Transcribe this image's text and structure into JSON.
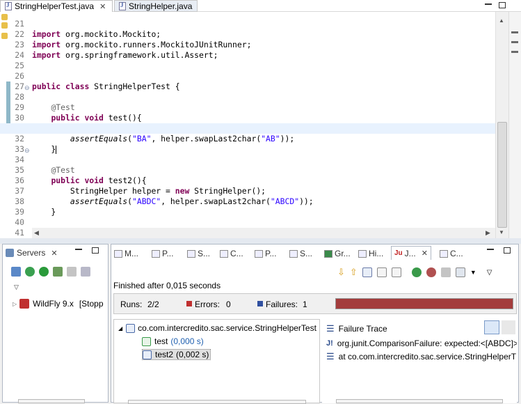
{
  "editor_tabs": [
    {
      "label": "StringHelperTest.java",
      "active": true
    },
    {
      "label": "StringHelper.java",
      "active": false
    }
  ],
  "code_lines": [
    {
      "num": "21",
      "text": "import org.mockito.Mockito;"
    },
    {
      "num": "22",
      "text": "import org.mockito.runners.MockitoJUnitRunner;"
    },
    {
      "num": "23",
      "text": "import org.springframework.util.Assert;"
    },
    {
      "num": "24",
      "text": ""
    },
    {
      "num": "25",
      "text": ""
    },
    {
      "num": "26",
      "text": "public class StringHelperTest {"
    },
    {
      "num": "27",
      "text": ""
    },
    {
      "num": "28",
      "text": "    @Test"
    },
    {
      "num": "29",
      "text": "    public void test(){"
    },
    {
      "num": "30",
      "text": "        StringHelper helper = new StringHelper();"
    },
    {
      "num": "31",
      "text": "        assertEquals(\"BA\", helper.swapLast2char(\"AB\"));"
    },
    {
      "num": "32",
      "text": "    }"
    },
    {
      "num": "33",
      "text": ""
    },
    {
      "num": "34",
      "text": "    @Test"
    },
    {
      "num": "35",
      "text": "    public void test2(){"
    },
    {
      "num": "36",
      "text": "        StringHelper helper = new StringHelper();"
    },
    {
      "num": "37",
      "text": "        assertEquals(\"ABDC\", helper.swapLast2char(\"ABCD\"));"
    },
    {
      "num": "38",
      "text": "    }"
    },
    {
      "num": "39",
      "text": ""
    },
    {
      "num": "40",
      "text": "}"
    },
    {
      "num": "41",
      "text": ""
    }
  ],
  "servers": {
    "tab_label": "Servers",
    "server_name": "WildFly 9.x",
    "server_status": "[Stopp"
  },
  "other_tabs": [
    "M...",
    "P...",
    "S...",
    "C...",
    "P...",
    "S...",
    "Gr...",
    "Hi...",
    "J...",
    "C..."
  ],
  "junit": {
    "finished": "Finished after 0,015 seconds",
    "runs_label": "Runs:",
    "runs_value": "2/2",
    "errors_label": "Errors:",
    "errors_value": "0",
    "failures_label": "Failures:",
    "failures_value": "1",
    "progress_fraction": 1.0,
    "progress_color": "#a33c3c",
    "suite": "co.com.intercredito.sac.service.StringHelperTest",
    "tests": [
      {
        "name": "test",
        "time": "(0,000 s)",
        "status": "pass"
      },
      {
        "name": "test2",
        "time": "(0,002 s)",
        "status": "fail"
      }
    ],
    "failure_trace_label": "Failure Trace",
    "trace_lines": [
      "org.junit.ComparisonFailure: expected:<[ABDC]>",
      "at co.com.intercredito.sac.service.StringHelperT"
    ]
  }
}
